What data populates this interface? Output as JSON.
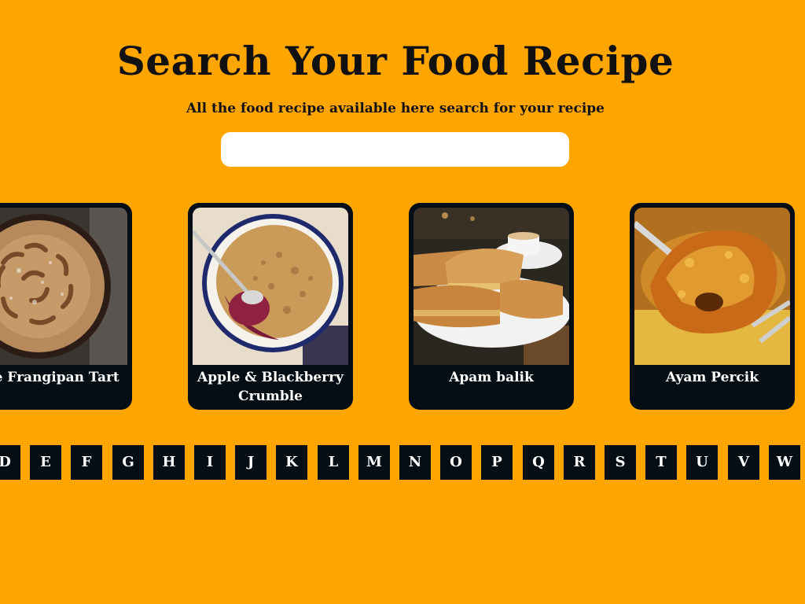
{
  "header": {
    "title": "Search Your Food Recipe",
    "subtitle": "All the food recipe available here search for your recipe"
  },
  "search": {
    "value": "",
    "placeholder": ""
  },
  "recipes": [
    {
      "name": "ple Frangipan Tart",
      "image": "apple-frangipan-tart-photo"
    },
    {
      "name": "Apple & Blackberry Crumble",
      "image": "apple-blackberry-crumble-photo"
    },
    {
      "name": "Apam balik",
      "image": "apam-balik-photo"
    },
    {
      "name": "Ayam Percik",
      "image": "ayam-percik-photo"
    }
  ],
  "alphabet": [
    "D",
    "E",
    "F",
    "G",
    "H",
    "I",
    "J",
    "K",
    "L",
    "M",
    "N",
    "O",
    "P",
    "Q",
    "R",
    "S",
    "T",
    "U",
    "V",
    "W"
  ],
  "colors": {
    "background": "#FFA500",
    "card": "#050E14",
    "text_dark": "#111111",
    "text_light": "#FFFFFF"
  }
}
